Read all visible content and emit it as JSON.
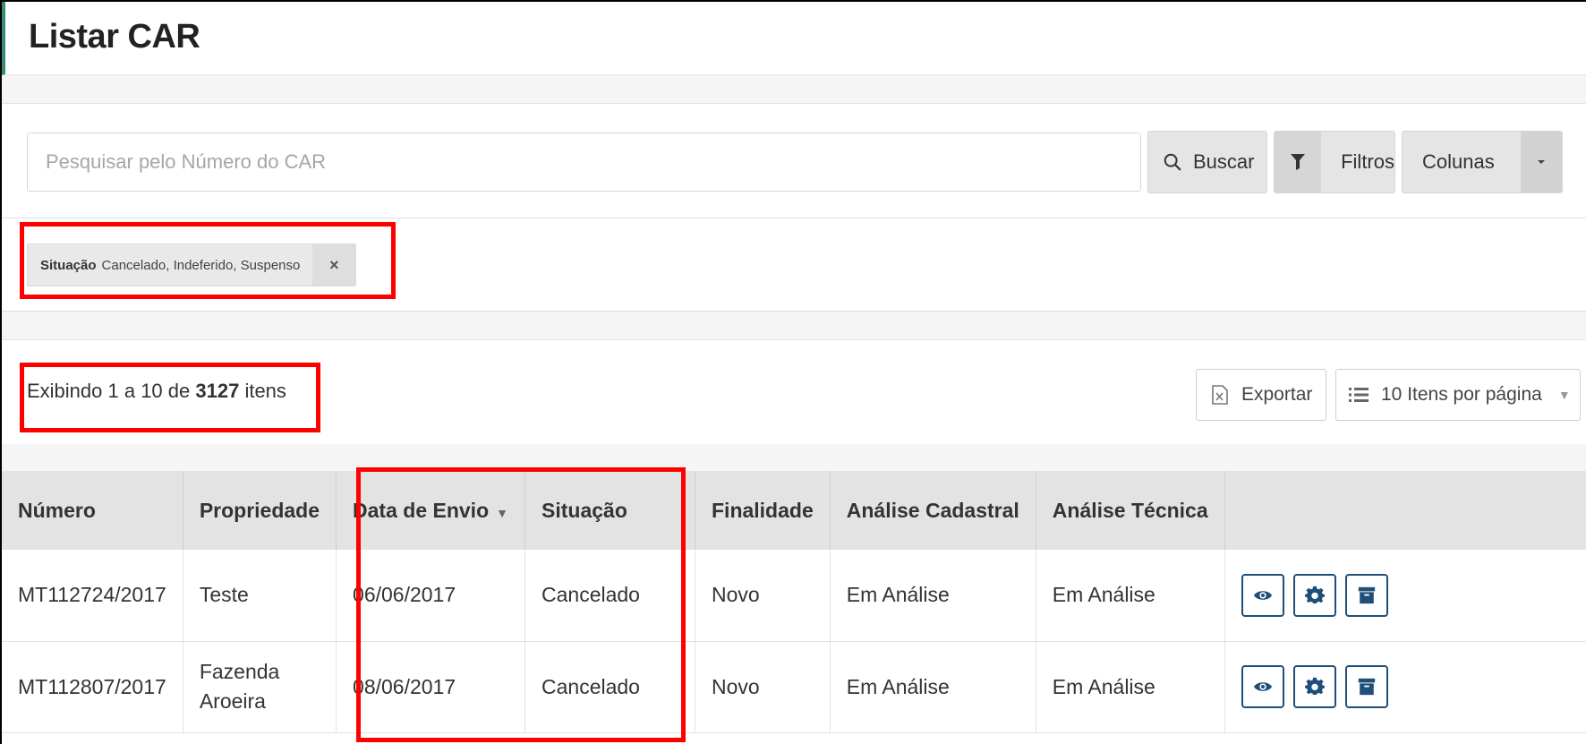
{
  "page": {
    "title": "Listar CAR"
  },
  "search": {
    "placeholder": "Pesquisar pelo Número do CAR",
    "buscar_label": "Buscar",
    "filtros_label": "Filtros",
    "colunas_label": "Colunas"
  },
  "filter_tag": {
    "key": "Situação",
    "value": "Cancelado, Indeferido, Suspenso",
    "close": "×"
  },
  "results": {
    "prefix": "Exibindo 1 a 10 de ",
    "total": "3127",
    "suffix": " itens"
  },
  "toolbar": {
    "exportar_label": "Exportar",
    "per_page_label": "10 Itens por página"
  },
  "table": {
    "headers": {
      "numero": "Número",
      "propriedade": "Propriedade",
      "data_envio": "Data de Envio",
      "situacao": "Situação",
      "finalidade": "Finalidade",
      "analise_cadastral": "Análise Cadastral",
      "analise_tecnica": "Análise Técnica"
    },
    "rows": [
      {
        "numero": "MT112724/2017",
        "propriedade": "Teste",
        "data_envio": "06/06/2017",
        "situacao": "Cancelado",
        "finalidade": "Novo",
        "analise_cadastral": "Em Análise",
        "analise_tecnica": "Em Análise"
      },
      {
        "numero": "MT112807/2017",
        "propriedade": "Fazenda Aroeira",
        "data_envio": "08/06/2017",
        "situacao": "Cancelado",
        "finalidade": "Novo",
        "analise_cadastral": "Em Análise",
        "analise_tecnica": "Em Análise"
      }
    ],
    "row_actions": [
      "eye-icon",
      "gear-icon",
      "archive-icon"
    ]
  },
  "colors": {
    "accent_bar": "#3b8a7a",
    "action_border": "#1f4f78",
    "highlight": "#ff0000"
  }
}
